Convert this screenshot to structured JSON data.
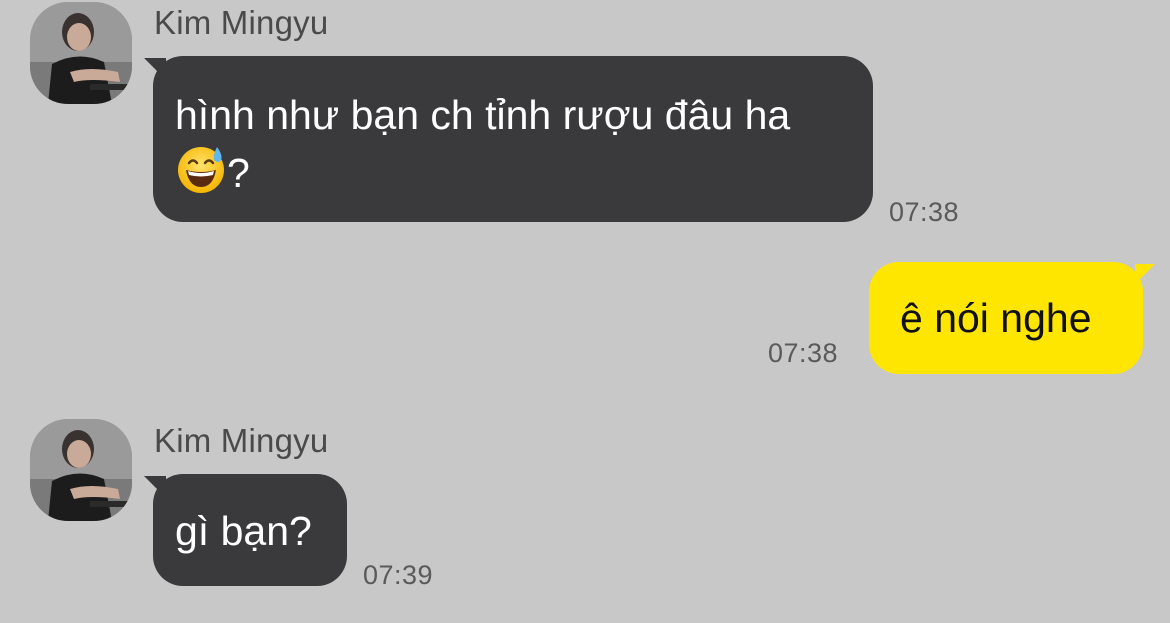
{
  "messages": [
    {
      "sender": "Kim Mingyu",
      "direction": "incoming",
      "text_line1": "hình như bạn ch tỉnh rượu đâu ha",
      "text_line2_emoji": "grinning-face-with-sweat-icon",
      "text_line2_suffix": "?",
      "time": "07:38"
    },
    {
      "direction": "outgoing",
      "text": "ê nói nghe",
      "time": "07:38"
    },
    {
      "sender": "Kim Mingyu",
      "direction": "incoming",
      "text": "gì bạn?",
      "time": "07:39"
    }
  ],
  "colors": {
    "background": "#c8c8c8",
    "incoming_bubble": "#3a3a3c",
    "outgoing_bubble": "#ffe600"
  }
}
